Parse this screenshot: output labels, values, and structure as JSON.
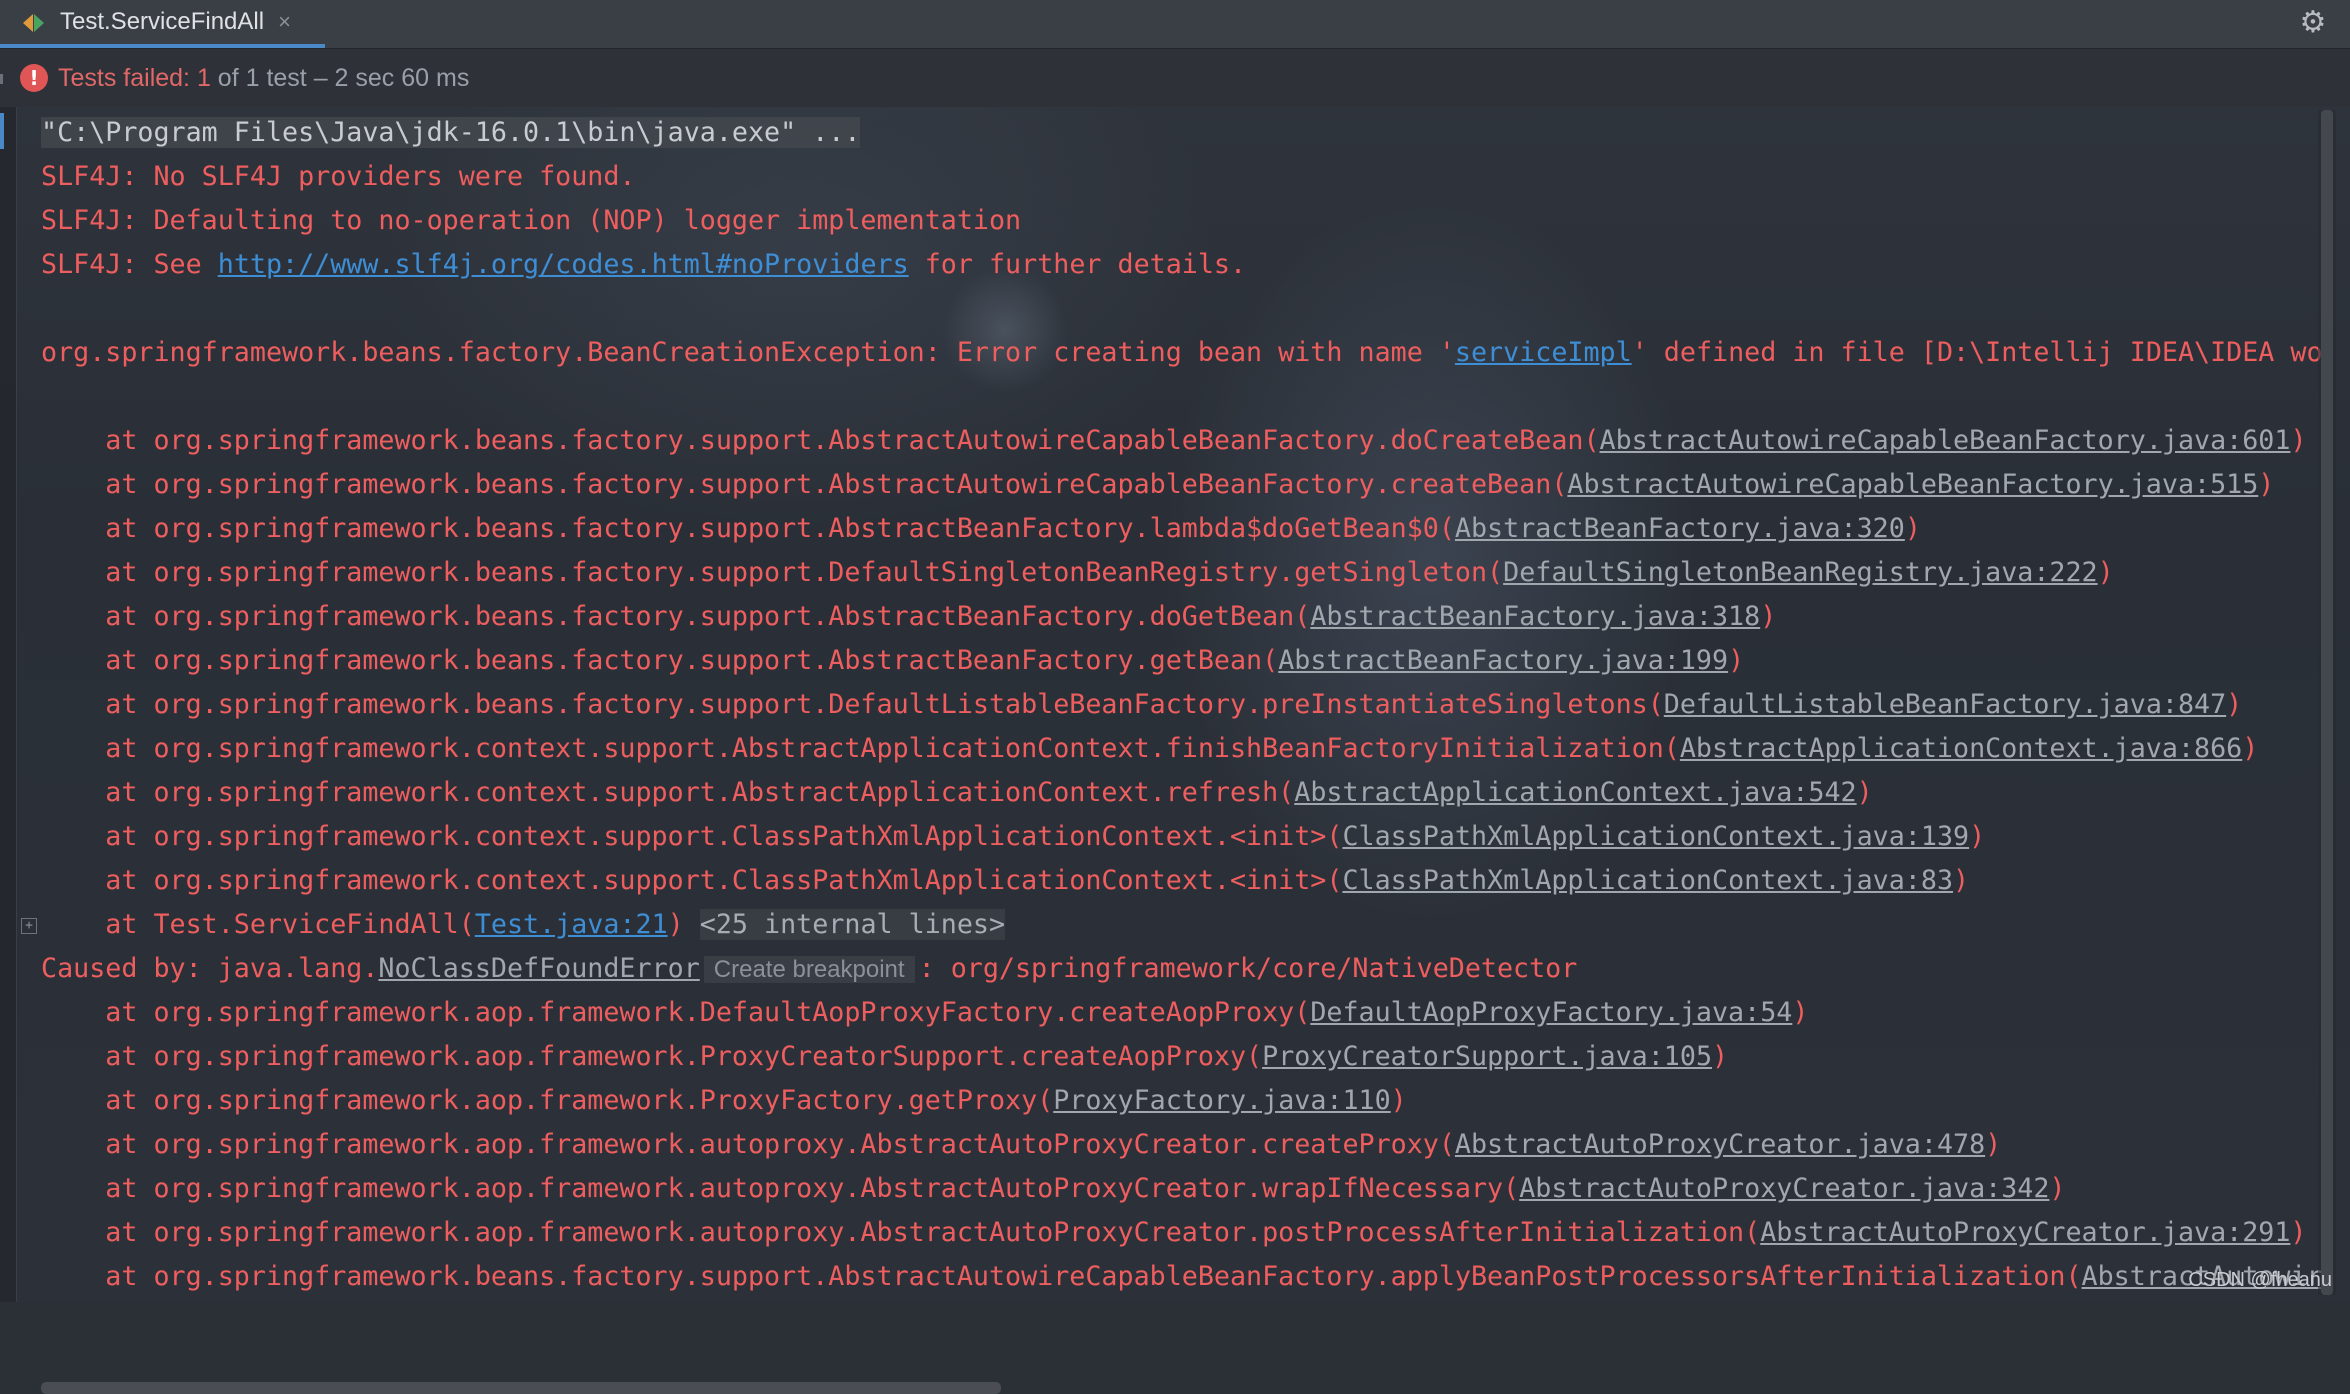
{
  "tab": {
    "label": "Test.ServiceFindAll",
    "close": "×"
  },
  "status": {
    "failed_label": "Tests failed: 1",
    "rest": " of 1 test – 2 sec 60 ms"
  },
  "console": {
    "cmd": "\"C:\\Program Files\\Java\\jdk-16.0.1\\bin\\java.exe\" ...",
    "slf1": "SLF4J: No SLF4J providers were found.",
    "slf2": "SLF4J: Defaulting to no-operation (NOP) logger implementation",
    "slf3_pre": "SLF4J: See ",
    "slf3_link": "http://www.slf4j.org/codes.html#noProviders",
    "slf3_post": " for further details.",
    "exc_pre": "org.springframework.beans.factory.BeanCreationException: Error creating bean with name '",
    "exc_link": "serviceImpl",
    "exc_post": "' defined in file [D:\\Intellij IDEA\\IDEA work",
    "stack1": [
      {
        "text": "    at org.springframework.beans.factory.support.AbstractAutowireCapableBeanFactory.doCreateBean(",
        "link": "AbstractAutowireCapableBeanFactory.java:601",
        "end": ")"
      },
      {
        "text": "    at org.springframework.beans.factory.support.AbstractAutowireCapableBeanFactory.createBean(",
        "link": "AbstractAutowireCapableBeanFactory.java:515",
        "end": ")"
      },
      {
        "text": "    at org.springframework.beans.factory.support.AbstractBeanFactory.lambda$doGetBean$0(",
        "link": "AbstractBeanFactory.java:320",
        "end": ")"
      },
      {
        "text": "    at org.springframework.beans.factory.support.DefaultSingletonBeanRegistry.getSingleton(",
        "link": "DefaultSingletonBeanRegistry.java:222",
        "end": ")"
      },
      {
        "text": "    at org.springframework.beans.factory.support.AbstractBeanFactory.doGetBean(",
        "link": "AbstractBeanFactory.java:318",
        "end": ")"
      },
      {
        "text": "    at org.springframework.beans.factory.support.AbstractBeanFactory.getBean(",
        "link": "AbstractBeanFactory.java:199",
        "end": ")"
      },
      {
        "text": "    at org.springframework.beans.factory.support.DefaultListableBeanFactory.preInstantiateSingletons(",
        "link": "DefaultListableBeanFactory.java:847",
        "end": ")"
      },
      {
        "text": "    at org.springframework.context.support.AbstractApplicationContext.finishBeanFactoryInitialization(",
        "link": "AbstractApplicationContext.java:866",
        "end": ")"
      },
      {
        "text": "    at org.springframework.context.support.AbstractApplicationContext.refresh(",
        "link": "AbstractApplicationContext.java:542",
        "end": ")"
      },
      {
        "text": "    at org.springframework.context.support.ClassPathXmlApplicationContext.<init>(",
        "link": "ClassPathXmlApplicationContext.java:139",
        "end": ")"
      },
      {
        "text": "    at org.springframework.context.support.ClassPathXmlApplicationContext.<init>(",
        "link": "ClassPathXmlApplicationContext.java:83",
        "end": ")"
      }
    ],
    "test_line_pre": "    at Test.ServiceFindAll(",
    "test_line_link": "Test.java:21",
    "test_line_end": ") ",
    "internal_lines": "<25 internal lines>",
    "caused_pre": "Caused by: java.lang.",
    "caused_link": "NoClassDefFoundError",
    "create_breakpoint": "Create breakpoint",
    "caused_post": ": org/springframework/core/NativeDetector",
    "stack2": [
      {
        "text": "    at org.springframework.aop.framework.DefaultAopProxyFactory.createAopProxy(",
        "link": "DefaultAopProxyFactory.java:54",
        "end": ")"
      },
      {
        "text": "    at org.springframework.aop.framework.ProxyCreatorSupport.createAopProxy(",
        "link": "ProxyCreatorSupport.java:105",
        "end": ")"
      },
      {
        "text": "    at org.springframework.aop.framework.ProxyFactory.getProxy(",
        "link": "ProxyFactory.java:110",
        "end": ")"
      },
      {
        "text": "    at org.springframework.aop.framework.autoproxy.AbstractAutoProxyCreator.createProxy(",
        "link": "AbstractAutoProxyCreator.java:478",
        "end": ")"
      },
      {
        "text": "    at org.springframework.aop.framework.autoproxy.AbstractAutoProxyCreator.wrapIfNecessary(",
        "link": "AbstractAutoProxyCreator.java:342",
        "end": ")"
      },
      {
        "text": "    at org.springframework.aop.framework.autoproxy.AbstractAutoProxyCreator.postProcessAfterInitialization(",
        "link": "AbstractAutoProxyCreator.java:291",
        "end": ")"
      },
      {
        "text": "    at org.springframework.beans.factory.support.AbstractAutowireCapableBeanFactory.applyBeanPostProcessorsAfterInitialization(",
        "link": "AbstractAutowireCa",
        "end": ""
      }
    ]
  },
  "watermark": "CSDN @fheanu",
  "colors": {
    "error_red": "#ee5e5e",
    "link_blue": "#3e8ed6",
    "tab_underline": "#4a88c7"
  }
}
